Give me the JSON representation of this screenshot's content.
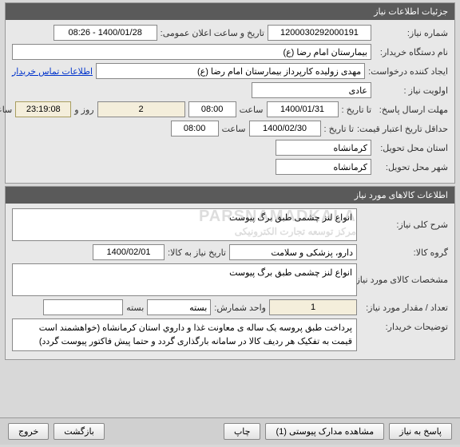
{
  "panel1": {
    "title": "جزئیات اطلاعات نیاز",
    "need_number_label": "شماره نیاز:",
    "need_number": "1200030292000191",
    "public_announce_label": "تاریخ و ساعت اعلان عمومی:",
    "public_announce": "1400/01/28 - 08:26",
    "device_name_label": "نام دستگاه خریدار:",
    "device_name": "بیمارستان امام رضا (ع)",
    "creator_label": "ایجاد کننده درخواست:",
    "creator": "مهدی زولیده کارپرداز بیمارستان امام رضا (ع)",
    "contact_link": "اطلاعات تماس خریدار",
    "priority_label": "اولویت نیاز :",
    "priority": "عادی",
    "deadline_label": "مهلت ارسال پاسخ:",
    "to_date_label": "تا تاریخ :",
    "deadline_date": "1400/01/31",
    "time_label": "ساعت",
    "deadline_time": "08:00",
    "days_value": "2",
    "days_label": "روز و",
    "countdown": "23:19:08",
    "remaining_label": "ساعت باقی مانده",
    "min_validity_label": "حداقل تاریخ اعتبار قیمت:",
    "validity_to_label": "تا تاریخ :",
    "validity_date": "1400/02/30",
    "validity_time": "08:00",
    "state_label": "استان محل تحویل:",
    "state": "کرمانشاه",
    "city_label": "شهر محل تحویل:",
    "city": "کرمانشاه"
  },
  "panel2": {
    "title": "اطلاعات کالاهای مورد نیاز",
    "need_desc_label": "شرح کلی نیاز:",
    "need_desc": "انواع لنز چشمی طبق برگ پیوست",
    "group_label": "گروه کالا:",
    "group": "دارو، پزشکی و سلامت",
    "need_date_label": "تاریخ نیاز به کالا:",
    "need_date": "1400/02/01",
    "spec_label": "مشخصات کالای مورد نیاز:",
    "spec": "انواع لنز چشمی طبق برگ پیوست",
    "qty_label": "تعداد / مقدار مورد نیاز:",
    "qty": "1",
    "unit_label": "واحد شمارش:",
    "unit": "بسته",
    "pack_label": "بسته",
    "pack_value": "",
    "notes_label": "توضیحات خریدار:",
    "notes": "پرداخت طبق پروسه یک ساله ی معاونت غذا و داروي استان کرمانشاه (خواهشمند است قیمت به تفکیک هر ردیف کالا در سامانه بارگذاری گردد و حتما پیش فاکتور پیوست گردد)"
  },
  "footer": {
    "reply": "پاسخ به نیاز",
    "attachments": "مشاهده مدارک پیوستی  (1)",
    "print": "چاپ",
    "back": "بازگشت",
    "exit": "خروج"
  }
}
